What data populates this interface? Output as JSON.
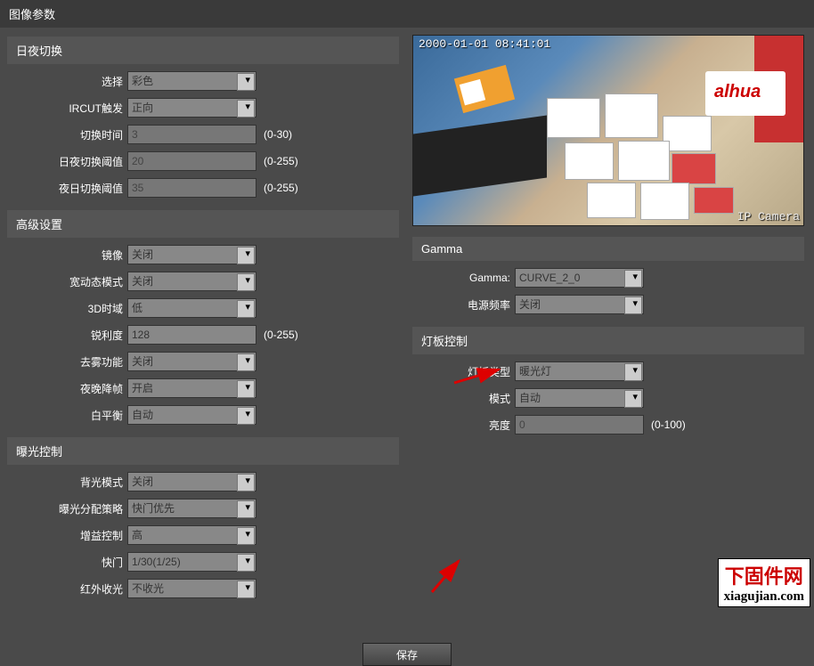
{
  "title": "图像参数",
  "sections": {
    "dayNight": {
      "header": "日夜切换",
      "select_label": "选择",
      "select_value": "彩色",
      "ircut_label": "IRCUT触发",
      "ircut_value": "正向",
      "switch_time_label": "切换时间",
      "switch_time_value": "3",
      "switch_time_hint": "(0-30)",
      "dn_thresh_label": "日夜切换阈值",
      "dn_thresh_value": "20",
      "dn_thresh_hint": "(0-255)",
      "nd_thresh_label": "夜日切换阈值",
      "nd_thresh_value": "35",
      "nd_thresh_hint": "(0-255)"
    },
    "advanced": {
      "header": "高级设置",
      "mirror_label": "镜像",
      "mirror_value": "关闭",
      "wdr_label": "宽动态模式",
      "wdr_value": "关闭",
      "dnr_label": "3D时域",
      "dnr_value": "低",
      "sharp_label": "锐利度",
      "sharp_value": "128",
      "sharp_hint": "(0-255)",
      "defog_label": "去雾功能",
      "defog_value": "关闭",
      "nightdrop_label": "夜晚降帧",
      "nightdrop_value": "开启",
      "wb_label": "白平衡",
      "wb_value": "自动"
    },
    "exposure": {
      "header": "曝光控制",
      "backlight_label": "背光模式",
      "backlight_value": "关闭",
      "expo_alloc_label": "曝光分配策略",
      "expo_alloc_value": "快门优先",
      "gain_label": "增益控制",
      "gain_value": "高",
      "shutter_label": "快门",
      "shutter_value": "1/30(1/25)",
      "ir_label": "红外收光",
      "ir_value": "不收光"
    },
    "gamma": {
      "header": "Gamma",
      "gamma_label": "Gamma:",
      "gamma_value": "CURVE_2_0",
      "freq_label": "电源频率",
      "freq_value": "关闭"
    },
    "light": {
      "header": "灯板控制",
      "type_label": "灯板类型",
      "type_value": "暖光灯",
      "mode_label": "模式",
      "mode_value": "自动",
      "brightness_label": "亮度",
      "brightness_value": "0",
      "brightness_hint": "(0-100)"
    }
  },
  "preview": {
    "timestamp": "2000-01-01 08:41:01",
    "watermark": "IP Camera"
  },
  "save_button": "保存",
  "site_watermark": {
    "cn": "下固件网",
    "en": "xiagujian.com"
  }
}
